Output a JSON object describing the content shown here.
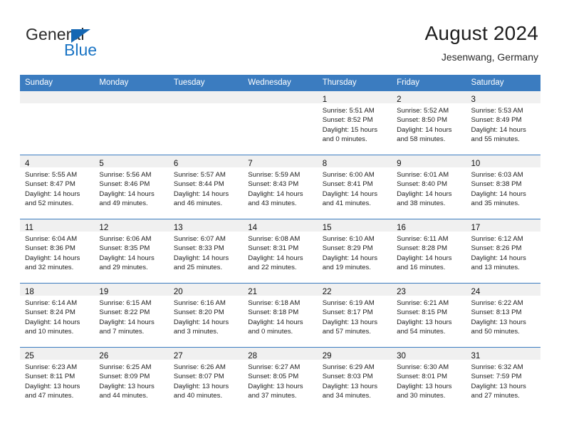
{
  "brand": {
    "name_part1": "General",
    "name_part2": "Blue",
    "triangle_color": "#1567b3",
    "blue_color": "#1a74c4"
  },
  "header": {
    "title": "August 2024",
    "location": "Jesenwang, Germany"
  },
  "theme": {
    "header_blue": "#3b7cc0",
    "daynum_band": "#f0f0f0",
    "cell_background": "#ffffff"
  },
  "calendar": {
    "weekday_headers": [
      "Sunday",
      "Monday",
      "Tuesday",
      "Wednesday",
      "Thursday",
      "Friday",
      "Saturday"
    ],
    "weeks": [
      [
        {
          "day": "",
          "empty": true
        },
        {
          "day": "",
          "empty": true
        },
        {
          "day": "",
          "empty": true
        },
        {
          "day": "",
          "empty": true
        },
        {
          "day": "1",
          "sunrise": "Sunrise: 5:51 AM",
          "sunset": "Sunset: 8:52 PM",
          "daylight1": "Daylight: 15 hours",
          "daylight2": "and 0 minutes."
        },
        {
          "day": "2",
          "sunrise": "Sunrise: 5:52 AM",
          "sunset": "Sunset: 8:50 PM",
          "daylight1": "Daylight: 14 hours",
          "daylight2": "and 58 minutes."
        },
        {
          "day": "3",
          "sunrise": "Sunrise: 5:53 AM",
          "sunset": "Sunset: 8:49 PM",
          "daylight1": "Daylight: 14 hours",
          "daylight2": "and 55 minutes."
        }
      ],
      [
        {
          "day": "4",
          "sunrise": "Sunrise: 5:55 AM",
          "sunset": "Sunset: 8:47 PM",
          "daylight1": "Daylight: 14 hours",
          "daylight2": "and 52 minutes."
        },
        {
          "day": "5",
          "sunrise": "Sunrise: 5:56 AM",
          "sunset": "Sunset: 8:46 PM",
          "daylight1": "Daylight: 14 hours",
          "daylight2": "and 49 minutes."
        },
        {
          "day": "6",
          "sunrise": "Sunrise: 5:57 AM",
          "sunset": "Sunset: 8:44 PM",
          "daylight1": "Daylight: 14 hours",
          "daylight2": "and 46 minutes."
        },
        {
          "day": "7",
          "sunrise": "Sunrise: 5:59 AM",
          "sunset": "Sunset: 8:43 PM",
          "daylight1": "Daylight: 14 hours",
          "daylight2": "and 43 minutes."
        },
        {
          "day": "8",
          "sunrise": "Sunrise: 6:00 AM",
          "sunset": "Sunset: 8:41 PM",
          "daylight1": "Daylight: 14 hours",
          "daylight2": "and 41 minutes."
        },
        {
          "day": "9",
          "sunrise": "Sunrise: 6:01 AM",
          "sunset": "Sunset: 8:40 PM",
          "daylight1": "Daylight: 14 hours",
          "daylight2": "and 38 minutes."
        },
        {
          "day": "10",
          "sunrise": "Sunrise: 6:03 AM",
          "sunset": "Sunset: 8:38 PM",
          "daylight1": "Daylight: 14 hours",
          "daylight2": "and 35 minutes."
        }
      ],
      [
        {
          "day": "11",
          "sunrise": "Sunrise: 6:04 AM",
          "sunset": "Sunset: 8:36 PM",
          "daylight1": "Daylight: 14 hours",
          "daylight2": "and 32 minutes."
        },
        {
          "day": "12",
          "sunrise": "Sunrise: 6:06 AM",
          "sunset": "Sunset: 8:35 PM",
          "daylight1": "Daylight: 14 hours",
          "daylight2": "and 29 minutes."
        },
        {
          "day": "13",
          "sunrise": "Sunrise: 6:07 AM",
          "sunset": "Sunset: 8:33 PM",
          "daylight1": "Daylight: 14 hours",
          "daylight2": "and 25 minutes."
        },
        {
          "day": "14",
          "sunrise": "Sunrise: 6:08 AM",
          "sunset": "Sunset: 8:31 PM",
          "daylight1": "Daylight: 14 hours",
          "daylight2": "and 22 minutes."
        },
        {
          "day": "15",
          "sunrise": "Sunrise: 6:10 AM",
          "sunset": "Sunset: 8:29 PM",
          "daylight1": "Daylight: 14 hours",
          "daylight2": "and 19 minutes."
        },
        {
          "day": "16",
          "sunrise": "Sunrise: 6:11 AM",
          "sunset": "Sunset: 8:28 PM",
          "daylight1": "Daylight: 14 hours",
          "daylight2": "and 16 minutes."
        },
        {
          "day": "17",
          "sunrise": "Sunrise: 6:12 AM",
          "sunset": "Sunset: 8:26 PM",
          "daylight1": "Daylight: 14 hours",
          "daylight2": "and 13 minutes."
        }
      ],
      [
        {
          "day": "18",
          "sunrise": "Sunrise: 6:14 AM",
          "sunset": "Sunset: 8:24 PM",
          "daylight1": "Daylight: 14 hours",
          "daylight2": "and 10 minutes."
        },
        {
          "day": "19",
          "sunrise": "Sunrise: 6:15 AM",
          "sunset": "Sunset: 8:22 PM",
          "daylight1": "Daylight: 14 hours",
          "daylight2": "and 7 minutes."
        },
        {
          "day": "20",
          "sunrise": "Sunrise: 6:16 AM",
          "sunset": "Sunset: 8:20 PM",
          "daylight1": "Daylight: 14 hours",
          "daylight2": "and 3 minutes."
        },
        {
          "day": "21",
          "sunrise": "Sunrise: 6:18 AM",
          "sunset": "Sunset: 8:18 PM",
          "daylight1": "Daylight: 14 hours",
          "daylight2": "and 0 minutes."
        },
        {
          "day": "22",
          "sunrise": "Sunrise: 6:19 AM",
          "sunset": "Sunset: 8:17 PM",
          "daylight1": "Daylight: 13 hours",
          "daylight2": "and 57 minutes."
        },
        {
          "day": "23",
          "sunrise": "Sunrise: 6:21 AM",
          "sunset": "Sunset: 8:15 PM",
          "daylight1": "Daylight: 13 hours",
          "daylight2": "and 54 minutes."
        },
        {
          "day": "24",
          "sunrise": "Sunrise: 6:22 AM",
          "sunset": "Sunset: 8:13 PM",
          "daylight1": "Daylight: 13 hours",
          "daylight2": "and 50 minutes."
        }
      ],
      [
        {
          "day": "25",
          "sunrise": "Sunrise: 6:23 AM",
          "sunset": "Sunset: 8:11 PM",
          "daylight1": "Daylight: 13 hours",
          "daylight2": "and 47 minutes."
        },
        {
          "day": "26",
          "sunrise": "Sunrise: 6:25 AM",
          "sunset": "Sunset: 8:09 PM",
          "daylight1": "Daylight: 13 hours",
          "daylight2": "and 44 minutes."
        },
        {
          "day": "27",
          "sunrise": "Sunrise: 6:26 AM",
          "sunset": "Sunset: 8:07 PM",
          "daylight1": "Daylight: 13 hours",
          "daylight2": "and 40 minutes."
        },
        {
          "day": "28",
          "sunrise": "Sunrise: 6:27 AM",
          "sunset": "Sunset: 8:05 PM",
          "daylight1": "Daylight: 13 hours",
          "daylight2": "and 37 minutes."
        },
        {
          "day": "29",
          "sunrise": "Sunrise: 6:29 AM",
          "sunset": "Sunset: 8:03 PM",
          "daylight1": "Daylight: 13 hours",
          "daylight2": "and 34 minutes."
        },
        {
          "day": "30",
          "sunrise": "Sunrise: 6:30 AM",
          "sunset": "Sunset: 8:01 PM",
          "daylight1": "Daylight: 13 hours",
          "daylight2": "and 30 minutes."
        },
        {
          "day": "31",
          "sunrise": "Sunrise: 6:32 AM",
          "sunset": "Sunset: 7:59 PM",
          "daylight1": "Daylight: 13 hours",
          "daylight2": "and 27 minutes."
        }
      ]
    ]
  }
}
